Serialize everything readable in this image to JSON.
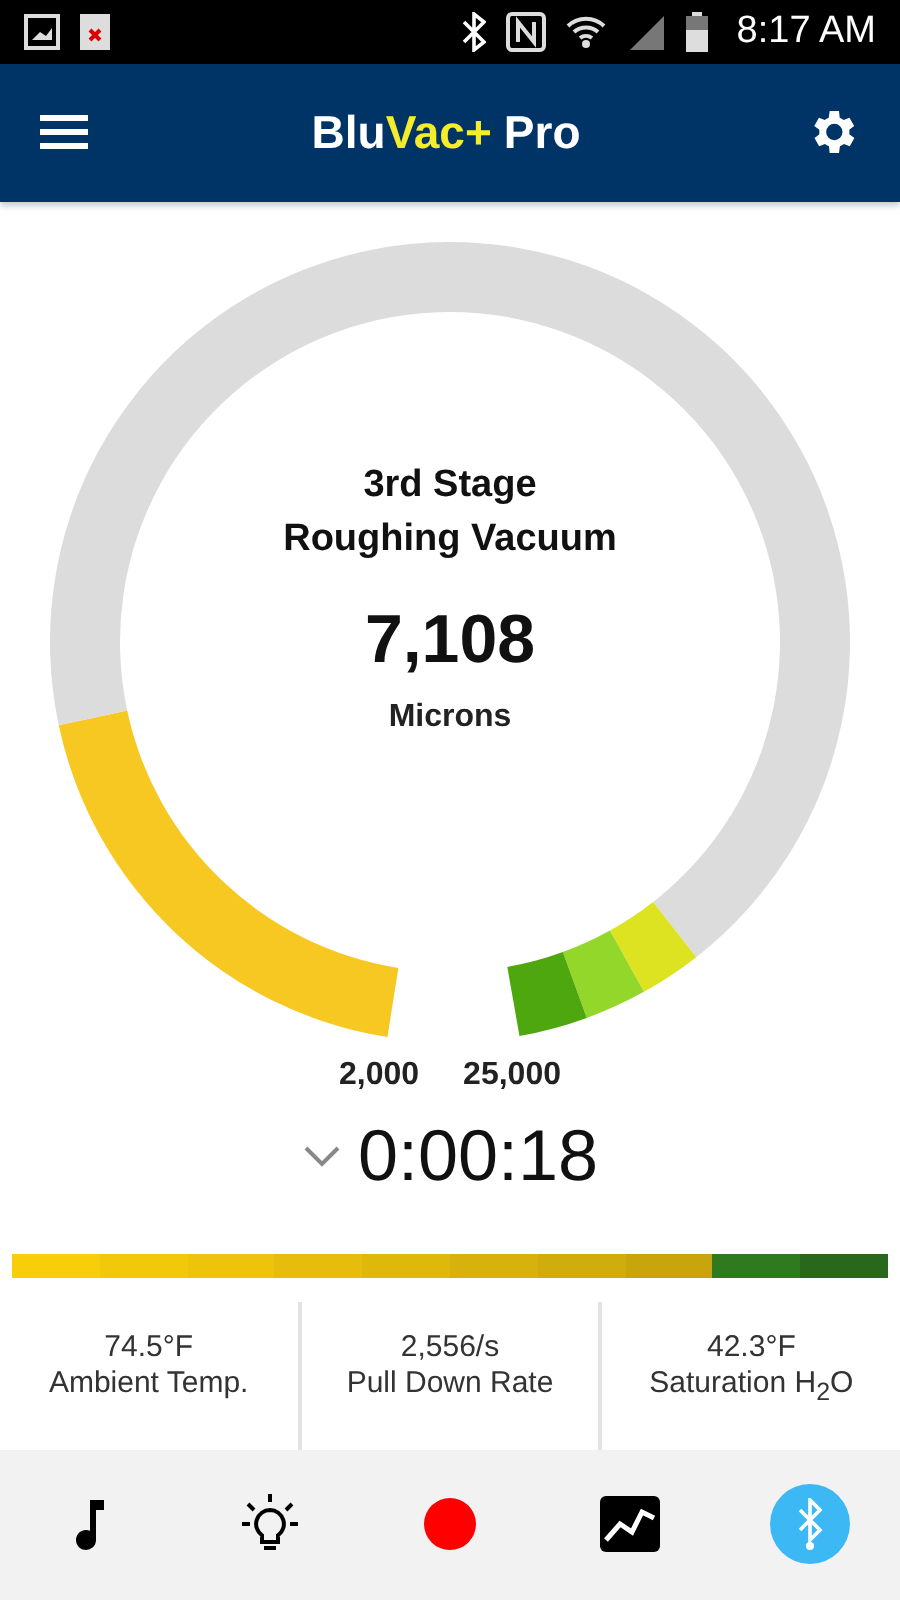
{
  "status_bar": {
    "time": "8:17 AM"
  },
  "app_bar": {
    "title": [
      {
        "text": "Blu",
        "highlight": false
      },
      {
        "text": "Vac+",
        "highlight": true
      },
      {
        "text": "Pro",
        "highlight": false
      }
    ]
  },
  "gauge": {
    "stage": "3rd Stage",
    "phase": "Roughing Vacuum",
    "reading": "7,108",
    "unit": "Microns",
    "left_label": "2,000",
    "right_label": "25,000",
    "segments": [
      {
        "color": "#f8c822"
      },
      {
        "color": "#dcdcdc"
      },
      {
        "color": "#dde321"
      },
      {
        "color": "#93d72a"
      },
      {
        "color": "#4ea70e"
      }
    ]
  },
  "timer": {
    "expanded": false,
    "time": "0:00:18"
  },
  "scale": [
    {
      "color": "#f8cd0a"
    },
    {
      "color": "#f2c80b"
    },
    {
      "color": "#edc30c"
    },
    {
      "color": "#e6bd0c"
    },
    {
      "color": "#dfb80c"
    },
    {
      "color": "#d8b20c"
    },
    {
      "color": "#d1ac0d"
    },
    {
      "color": "#c8a50d"
    },
    {
      "color": "#2f7a1f"
    },
    {
      "color": "#28681c"
    }
  ],
  "stats": [
    {
      "value": "74.5°F",
      "label": "Ambient Temp."
    },
    {
      "value": "2,556/s",
      "label": "Pull Down Rate"
    },
    {
      "value": "42.3°F",
      "label": "Saturation H$_{2}$O"
    }
  ],
  "nav": [
    {
      "kind": "music",
      "selected": false
    },
    {
      "kind": "light",
      "selected": false
    },
    {
      "kind": "record",
      "selected": false
    },
    {
      "kind": "chart",
      "selected": false
    },
    {
      "kind": "bluetooth",
      "selected": true
    }
  ]
}
